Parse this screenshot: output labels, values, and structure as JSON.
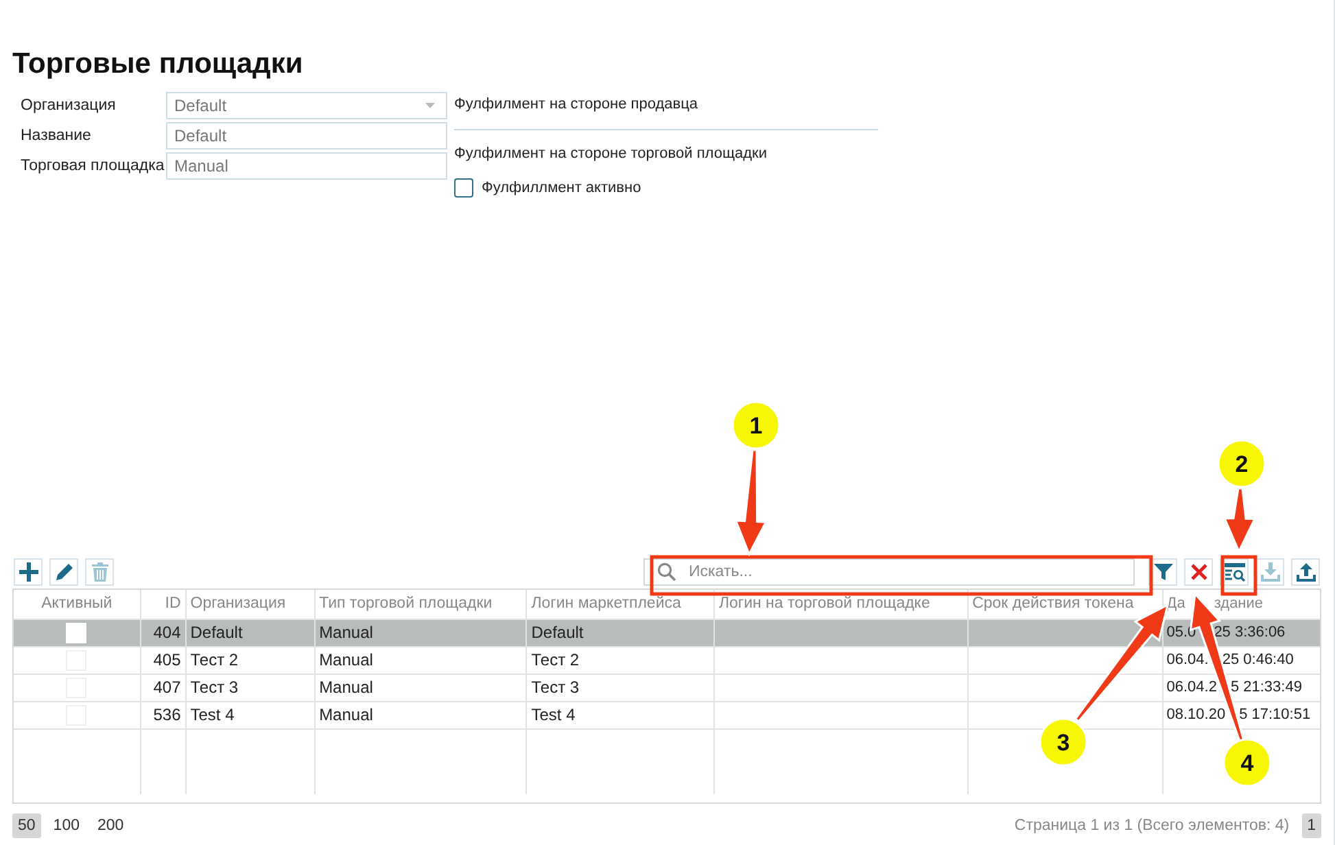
{
  "title": "Торговые площадки",
  "form": {
    "fields": [
      {
        "label": "Организация",
        "value": "Default",
        "kind": "select"
      },
      {
        "label": "Название",
        "value": "Default",
        "kind": "text"
      },
      {
        "label": "Торговая площадка",
        "value": "Manual",
        "kind": "text"
      }
    ],
    "fulfillment": {
      "seller_label": "Фулфилмент на стороне продавца",
      "marketplace_label": "Фулфилмент на стороне торговой площадки",
      "active": {
        "label": "Фулфиллмент активно",
        "checked": false
      }
    }
  },
  "toolbar": {
    "search": {
      "placeholder": "Искать..."
    }
  },
  "table": {
    "columns": [
      {
        "label": "Активный"
      },
      {
        "label": "ID"
      },
      {
        "label": "Организация"
      },
      {
        "label": "Тип торговой площадки"
      },
      {
        "label": "Логин маркетплейса"
      },
      {
        "label": "Логин на торговой площадке"
      },
      {
        "label": "Срок действия токена"
      },
      {
        "label": "Да",
        "label_end": "здание"
      }
    ],
    "rows": [
      {
        "active": false,
        "selected": true,
        "id": "404",
        "organization": "Default",
        "type": "Manual",
        "login": "Default",
        "created_start": "05.0",
        "created_end": "25 3:36:06"
      },
      {
        "active": false,
        "selected": false,
        "id": "405",
        "organization": "Тест 2",
        "type": "Manual",
        "login": "Тест 2",
        "created_start": "06.04.",
        "created_end": "25 0:46:40"
      },
      {
        "active": false,
        "selected": false,
        "id": "407",
        "organization": "Тест 3",
        "type": "Manual",
        "login": "Тест 3",
        "created_start": "06.04.2",
        "created_end": "5 21:33:49"
      },
      {
        "active": false,
        "selected": false,
        "id": "536",
        "organization": "Test 4",
        "type": "Manual",
        "login": "Test 4",
        "created_start": "08.10.20",
        "created_end": "5 17:10:51"
      }
    ]
  },
  "pager": {
    "sizes": [
      {
        "label": "50",
        "selected": true
      },
      {
        "label": "100",
        "selected": false
      },
      {
        "label": "200",
        "selected": false
      }
    ],
    "info": "Страница 1 из 1 (Всего элементов: 4)",
    "pages": [
      {
        "label": "1",
        "selected": true
      }
    ]
  },
  "annotations": [
    {
      "label": "1"
    },
    {
      "label": "2"
    },
    {
      "label": "3"
    },
    {
      "label": "4"
    }
  ]
}
